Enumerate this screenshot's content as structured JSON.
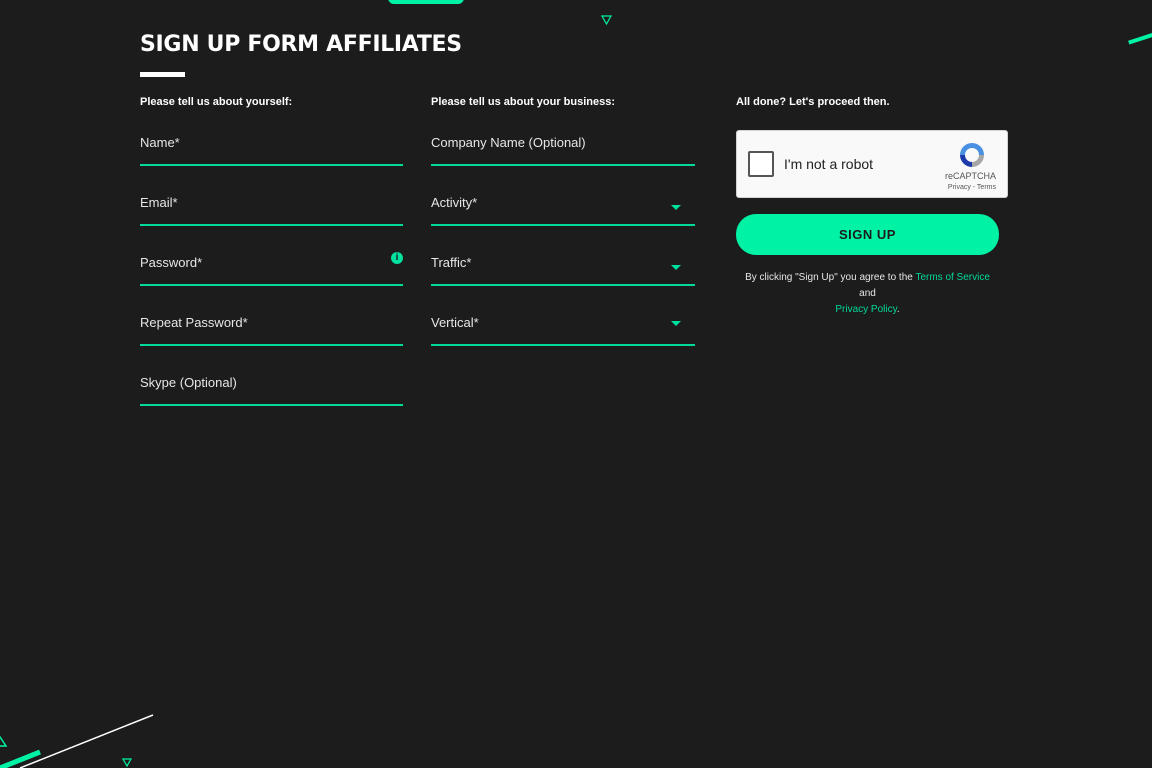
{
  "header": {
    "title": "SIGN UP FORM AFFILIATES"
  },
  "personal": {
    "section_label": "Please tell us about yourself:",
    "fields": [
      {
        "label": "Name*"
      },
      {
        "label": "Email*"
      },
      {
        "label": "Password*",
        "icon": "info-icon"
      },
      {
        "label": "Repeat Password*"
      },
      {
        "label": "Skype (Optional)"
      }
    ]
  },
  "business": {
    "section_label": "Please tell us about your business:",
    "fields": [
      {
        "label": "Company Name (Optional)"
      },
      {
        "label": "Activity*",
        "icon": "chevron-down-icon"
      },
      {
        "label": "Traffic*",
        "icon": "chevron-down-icon"
      },
      {
        "label": "Vertical*",
        "icon": "chevron-down-icon"
      }
    ]
  },
  "proceed": {
    "section_label": "All done? Let's proceed then.",
    "captcha": {
      "label": "I'm not a robot",
      "brand": "reCAPTCHA",
      "links": "Privacy - Terms"
    },
    "signup_label": "SIGN UP",
    "legal": {
      "prefix": "By clicking \"Sign Up\" you agree to the",
      "terms_link": "Terms of Service",
      "and": "and",
      "privacy_link": "Privacy Policy",
      "suffix": "."
    }
  },
  "colors": {
    "background": "#1c1c1c",
    "accent": "#00f2a4",
    "underline": "#00d99a"
  }
}
